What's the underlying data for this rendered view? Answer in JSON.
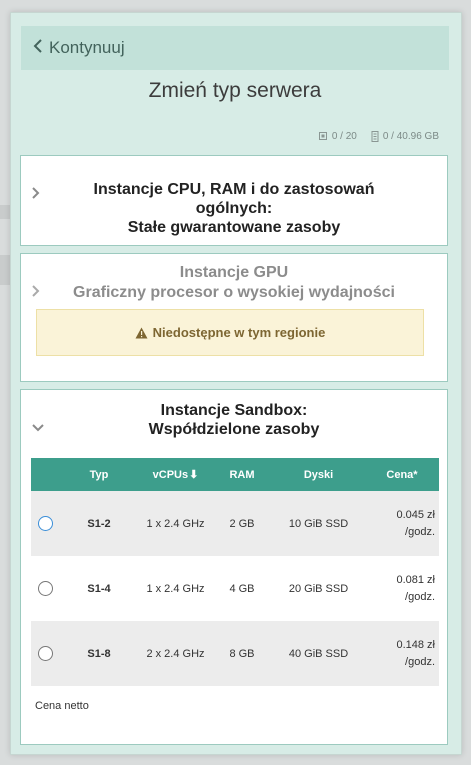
{
  "header": {
    "back_label": "Kontynuuj",
    "title": "Zmień typ serwera"
  },
  "quota": {
    "cpu": "0 / 20",
    "ram": "0 / 40.96 GB"
  },
  "cards": {
    "cpu": {
      "line1": "Instancje CPU, RAM i do zastosowań",
      "line2": "ogólnych:",
      "line3": "Stałe gwarantowane zasoby"
    },
    "gpu": {
      "line1": "Instancje GPU",
      "line2": "Graficzny procesor o wysokiej wydajności",
      "warning": "Niedostępne w tym regionie"
    },
    "sandbox": {
      "line1": "Instancje Sandbox:",
      "line2": "Współdzielone zasoby"
    }
  },
  "table": {
    "headers": [
      "Typ",
      "vCPUs",
      "RAM",
      "Dyski",
      "Cena*"
    ],
    "rows": [
      {
        "type": "S1-2",
        "vcpu": "1 x 2.4 GHz",
        "ram": "2 GB",
        "disk": "10 GiB SSD",
        "price": "0.045 zł",
        "unit": "/godz.",
        "selected": true
      },
      {
        "type": "S1-4",
        "vcpu": "1 x 2.4 GHz",
        "ram": "4 GB",
        "disk": "20 GiB SSD",
        "price": "0.081 zł",
        "unit": "/godz.",
        "selected": false
      },
      {
        "type": "S1-8",
        "vcpu": "2 x 2.4 GHz",
        "ram": "8 GB",
        "disk": "40 GiB SSD",
        "price": "0.148 zł",
        "unit": "/godz.",
        "selected": false
      }
    ]
  },
  "footnote": "Cena netto",
  "colors": {
    "panel_bg": "#d7ece6",
    "back_bar_bg": "#c2e1d9",
    "table_header_bg": "#3d9e8c",
    "radio_selected": "#3a8ed8",
    "warning_bg": "#faf3d8"
  },
  "icons": {
    "back": "chevron-left-icon",
    "cpu_quota": "cpu-chip-icon",
    "ram_quota": "memory-icon",
    "collapsed": "chevron-right-icon",
    "expanded": "chevron-down-icon",
    "warning": "warning-triangle-icon",
    "sort": "sort-down-icon"
  }
}
